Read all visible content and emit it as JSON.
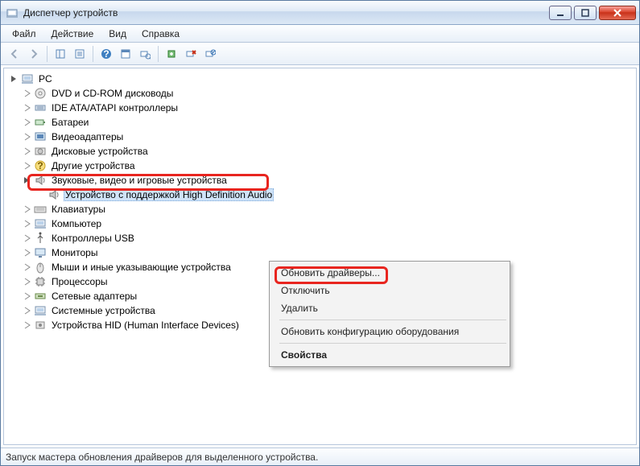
{
  "window": {
    "title": "Диспетчер устройств"
  },
  "menu": {
    "file": "Файл",
    "action": "Действие",
    "view": "Вид",
    "help": "Справка"
  },
  "tree": {
    "root": "PC",
    "items": [
      {
        "label": "DVD и CD-ROM дисководы"
      },
      {
        "label": "IDE ATA/ATAPI контроллеры"
      },
      {
        "label": "Батареи"
      },
      {
        "label": "Видеоадаптеры"
      },
      {
        "label": "Дисковые устройства"
      },
      {
        "label": "Другие устройства"
      },
      {
        "label": "Звуковые, видео и игровые устройства",
        "expanded": true,
        "children": [
          {
            "label": "Устройство с поддержкой High Definition Audio"
          }
        ]
      },
      {
        "label": "Клавиатуры"
      },
      {
        "label": "Компьютер"
      },
      {
        "label": "Контроллеры USB"
      },
      {
        "label": "Мониторы"
      },
      {
        "label": "Мыши и иные указывающие устройства"
      },
      {
        "label": "Процессоры"
      },
      {
        "label": "Сетевые адаптеры"
      },
      {
        "label": "Системные устройства"
      },
      {
        "label": "Устройства HID (Human Interface Devices)"
      }
    ]
  },
  "context_menu": {
    "update": "Обновить драйверы...",
    "disable": "Отключить",
    "delete": "Удалить",
    "scan": "Обновить конфигурацию оборудования",
    "properties": "Свойства"
  },
  "status": "Запуск мастера обновления драйверов для выделенного устройства."
}
